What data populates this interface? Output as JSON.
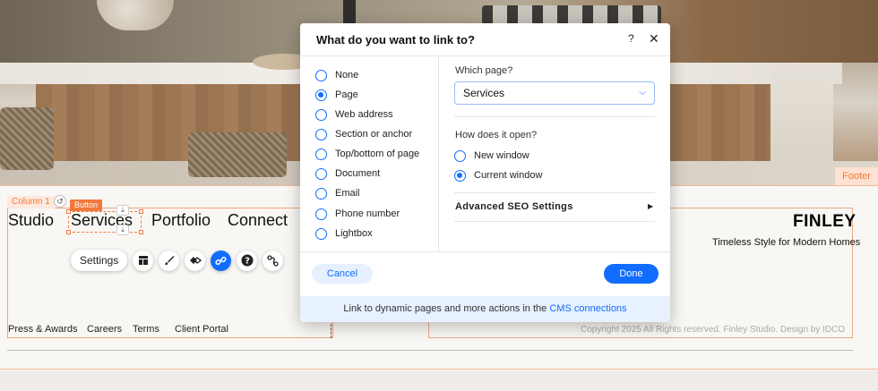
{
  "site": {
    "footer_tag": "Footer",
    "column_label": "Column 1",
    "button_tag": "Button",
    "nav": [
      "Studio",
      "Services",
      "Portfolio",
      "Connect"
    ],
    "brand": "FINLEY",
    "tagline": "Timeless Style for Modern Homes",
    "footer_links": [
      "Press & Awards",
      "Careers",
      "Terms",
      "Client Portal"
    ],
    "copyright": "Copyright 2025 All Rights reserved. Finley Studio. Design by IDCO"
  },
  "toolbar": {
    "settings_label": "Settings",
    "icons": [
      "layout-icon",
      "design-brush-icon",
      "animation-icon",
      "link-icon",
      "help-icon",
      "connect-icon"
    ]
  },
  "dialog": {
    "title": "What do you want to link to?",
    "help": "?",
    "close": "✕",
    "options": [
      "None",
      "Page",
      "Web address",
      "Section or anchor",
      "Top/bottom of page",
      "Document",
      "Email",
      "Phone number",
      "Lightbox"
    ],
    "selected_option": "Page",
    "which_page_label": "Which page?",
    "selected_page": "Services",
    "open_label": "How does it open?",
    "open_options": [
      "New window",
      "Current window"
    ],
    "selected_open": "Current window",
    "advanced_label": "Advanced SEO Settings",
    "cancel": "Cancel",
    "done": "Done",
    "footer_text": "Link to dynamic pages and more actions in the ",
    "footer_link": "CMS connections"
  },
  "colors": {
    "accent": "#116dff",
    "selection": "#f07a3d"
  }
}
